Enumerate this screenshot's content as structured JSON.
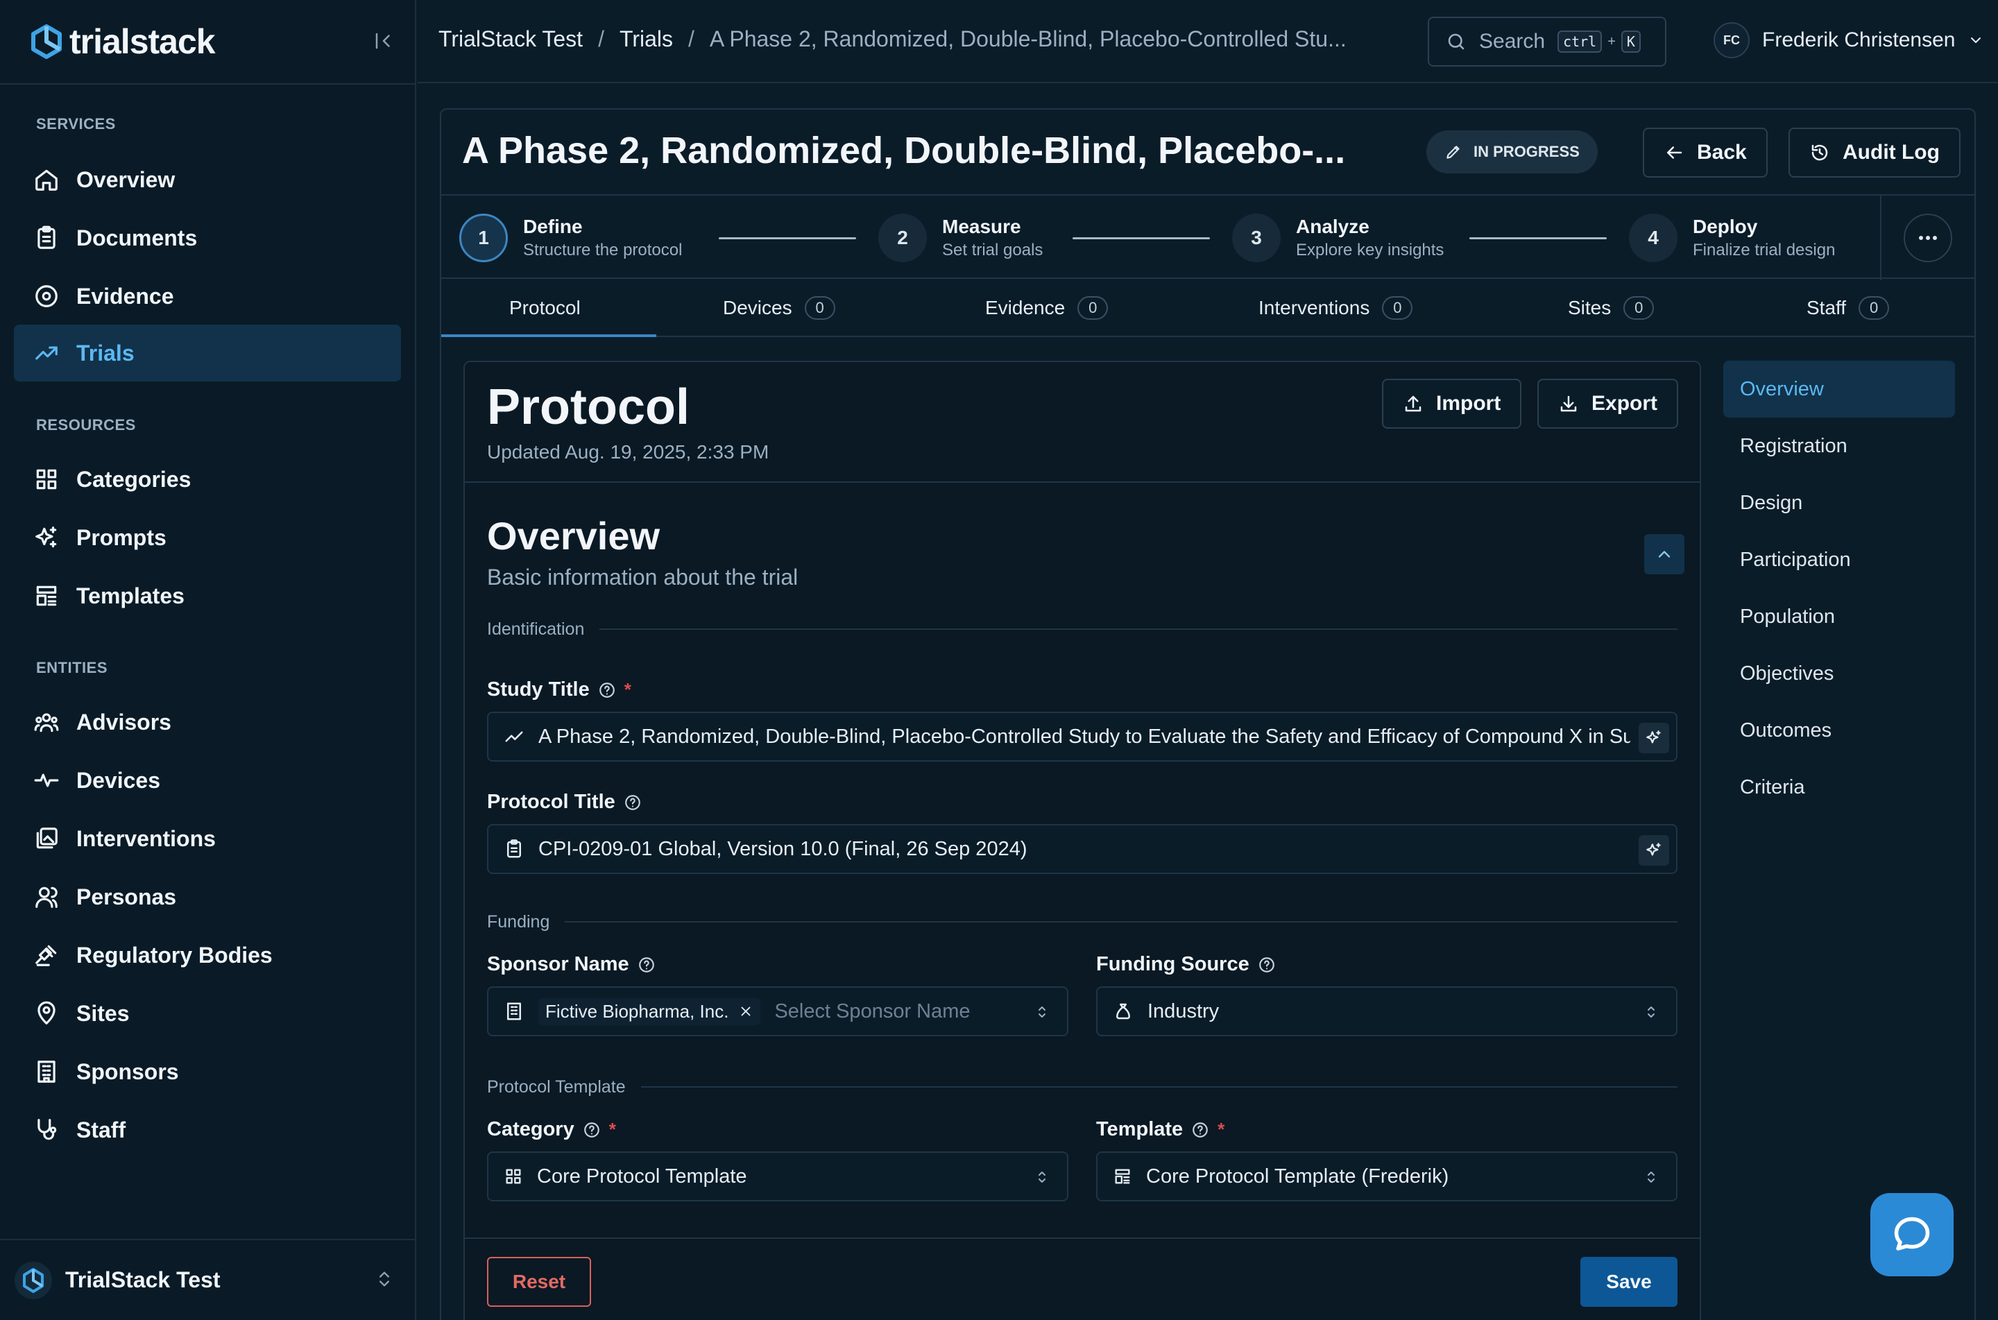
{
  "brand": {
    "name": "trialstack"
  },
  "sidebar": {
    "sections": [
      {
        "title": "SERVICES",
        "items": [
          {
            "label": "Overview",
            "icon": "home-icon"
          },
          {
            "label": "Documents",
            "icon": "clipboard-icon"
          },
          {
            "label": "Evidence",
            "icon": "eye-icon"
          },
          {
            "label": "Trials",
            "icon": "trend-icon",
            "active": true
          }
        ]
      },
      {
        "title": "RESOURCES",
        "items": [
          {
            "label": "Categories",
            "icon": "grid-icon"
          },
          {
            "label": "Prompts",
            "icon": "sparkles-icon"
          },
          {
            "label": "Templates",
            "icon": "template-icon"
          }
        ]
      },
      {
        "title": "ENTITIES",
        "items": [
          {
            "label": "Advisors",
            "icon": "users-icon"
          },
          {
            "label": "Devices",
            "icon": "activity-icon"
          },
          {
            "label": "Interventions",
            "icon": "gallery-icon"
          },
          {
            "label": "Personas",
            "icon": "user-icon"
          },
          {
            "label": "Regulatory Bodies",
            "icon": "gavel-icon"
          },
          {
            "label": "Sites",
            "icon": "map-pin-icon"
          },
          {
            "label": "Sponsors",
            "icon": "building-icon"
          },
          {
            "label": "Staff",
            "icon": "stethoscope-icon"
          }
        ]
      }
    ],
    "workspace": "TrialStack Test"
  },
  "topbar": {
    "breadcrumb": [
      "TrialStack Test",
      "Trials",
      "A Phase 2, Randomized, Double-Blind, Placebo-Controlled Stu..."
    ],
    "search": {
      "label": "Search",
      "kbd1": "ctrl",
      "plus": "+",
      "kbd2": "K"
    },
    "user": {
      "initials": "FC",
      "name": "Frederik Christensen"
    }
  },
  "trial": {
    "title": "A Phase 2, Randomized, Double-Blind, Placebo-...",
    "status": "IN PROGRESS",
    "back_label": "Back",
    "audit_label": "Audit Log"
  },
  "steps": [
    {
      "num": "1",
      "title": "Define",
      "subtitle": "Structure the protocol",
      "active": true
    },
    {
      "num": "2",
      "title": "Measure",
      "subtitle": "Set trial goals"
    },
    {
      "num": "3",
      "title": "Analyze",
      "subtitle": "Explore key insights"
    },
    {
      "num": "4",
      "title": "Deploy",
      "subtitle": "Finalize trial design"
    }
  ],
  "tabs": [
    {
      "label": "Protocol",
      "active": true
    },
    {
      "label": "Devices",
      "count": "0"
    },
    {
      "label": "Evidence",
      "count": "0"
    },
    {
      "label": "Interventions",
      "count": "0"
    },
    {
      "label": "Sites",
      "count": "0"
    },
    {
      "label": "Staff",
      "count": "0"
    }
  ],
  "protocol": {
    "title": "Protocol",
    "updated": "Updated Aug. 19, 2025, 2:33 PM",
    "import_label": "Import",
    "export_label": "Export",
    "section": {
      "title": "Overview",
      "subtitle": "Basic information about the trial"
    },
    "groups": {
      "identification": "Identification",
      "funding": "Funding",
      "template": "Protocol Template"
    },
    "fields": {
      "study_title": {
        "label": "Study Title",
        "required": "*",
        "value": "A Phase 2, Randomized, Double-Blind, Placebo-Controlled Study to Evaluate the Safety and Efficacy of Compound X in Subjects"
      },
      "protocol_title": {
        "label": "Protocol Title",
        "value": "CPI-0209-01 Global, Version 10.0 (Final, 26 Sep 2024)"
      },
      "sponsor_name": {
        "label": "Sponsor Name",
        "chip": "Fictive Biopharma, Inc.",
        "placeholder": "Select Sponsor Name"
      },
      "funding_source": {
        "label": "Funding Source",
        "value": "Industry"
      },
      "category": {
        "label": "Category",
        "required": "*",
        "value": "Core Protocol Template"
      },
      "template": {
        "label": "Template",
        "required": "*",
        "value": "Core Protocol Template (Frederik)"
      }
    },
    "reset_label": "Reset",
    "save_label": "Save"
  },
  "toc": [
    "Overview",
    "Registration",
    "Design",
    "Participation",
    "Population",
    "Objectives",
    "Outcomes",
    "Criteria"
  ],
  "colors": {
    "accent": "#5cb8f2",
    "primary": "#0d5796",
    "background": "#0b1c29",
    "danger": "#e46a63"
  }
}
